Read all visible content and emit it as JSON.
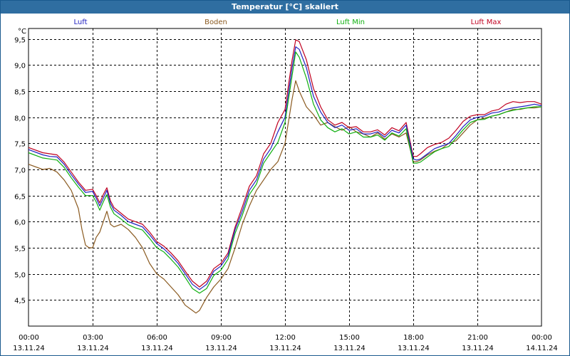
{
  "chart_data": {
    "type": "line",
    "title": "Temperatur [°C] skaliert",
    "ylabel": "°C",
    "ylim": [
      4.0,
      9.7
    ],
    "yticks": [
      4.5,
      5.0,
      5.5,
      6.0,
      6.5,
      7.0,
      7.5,
      8.0,
      8.5,
      9.0,
      9.5
    ],
    "ytick_labels": [
      "4,5",
      "5,0",
      "5,5",
      "6,0",
      "6,5",
      "7,0",
      "7,5",
      "8,0",
      "8,5",
      "9,0",
      "9,5"
    ],
    "xlim": [
      "13.11.24 00:00",
      "14.11.24 00:00"
    ],
    "xticks": [
      {
        "time": "00:00",
        "date": "13.11.24"
      },
      {
        "time": "03:00",
        "date": "13.11.24"
      },
      {
        "time": "06:00",
        "date": "13.11.24"
      },
      {
        "time": "09:00",
        "date": "13.11.24"
      },
      {
        "time": "12:00",
        "date": "13.11.24"
      },
      {
        "time": "15:00",
        "date": "13.11.24"
      },
      {
        "time": "18:00",
        "date": "13.11.24"
      },
      {
        "time": "21:00",
        "date": "13.11.24"
      },
      {
        "time": "00:00",
        "date": "14.11.24"
      }
    ],
    "grid": true,
    "legend_position": "top",
    "series": [
      {
        "name": "Luft",
        "color": "#2020c0",
        "x": [
          "00:00",
          "00:40",
          "01:00",
          "01:20",
          "01:40",
          "02:00",
          "02:20",
          "02:40",
          "03:00",
          "03:10",
          "03:20",
          "03:30",
          "03:40",
          "03:50",
          "04:00",
          "04:20",
          "04:40",
          "05:00",
          "05:20",
          "05:40",
          "06:00",
          "06:20",
          "06:40",
          "07:00",
          "07:20",
          "07:40",
          "08:00",
          "08:20",
          "08:40",
          "09:00",
          "09:20",
          "09:40",
          "10:00",
          "10:20",
          "10:40",
          "11:00",
          "11:20",
          "11:40",
          "12:00",
          "12:20",
          "12:30",
          "12:40",
          "13:00",
          "13:20",
          "13:40",
          "14:00",
          "14:20",
          "14:40",
          "15:00",
          "15:20",
          "15:40",
          "16:00",
          "16:20",
          "16:40",
          "17:00",
          "17:20",
          "17:40",
          "18:00",
          "18:10",
          "18:20",
          "18:40",
          "19:00",
          "19:20",
          "19:40",
          "20:00",
          "20:20",
          "20:40",
          "21:00",
          "21:20",
          "21:40",
          "22:00",
          "22:20",
          "22:40",
          "23:00",
          "23:20",
          "23:40",
          "24:00"
        ],
        "y": [
          7.38,
          7.28,
          7.25,
          7.24,
          7.1,
          6.9,
          6.72,
          6.56,
          6.58,
          6.45,
          6.3,
          6.45,
          6.6,
          6.35,
          6.22,
          6.12,
          6.0,
          5.95,
          5.9,
          5.75,
          5.58,
          5.48,
          5.35,
          5.2,
          5.0,
          4.8,
          4.7,
          4.8,
          5.05,
          5.15,
          5.35,
          5.85,
          6.2,
          6.6,
          6.8,
          7.2,
          7.4,
          7.72,
          8.0,
          8.95,
          9.35,
          9.3,
          8.95,
          8.4,
          8.1,
          7.9,
          7.8,
          7.85,
          7.75,
          7.78,
          7.68,
          7.68,
          7.72,
          7.62,
          7.75,
          7.7,
          7.85,
          7.2,
          7.18,
          7.2,
          7.3,
          7.4,
          7.45,
          7.5,
          7.65,
          7.82,
          7.95,
          8.0,
          8.02,
          8.08,
          8.1,
          8.15,
          8.18,
          8.2,
          8.22,
          8.25,
          8.22
        ]
      },
      {
        "name": "Boden",
        "color": "#8a5a20",
        "x": [
          "00:00",
          "00:40",
          "01:00",
          "01:20",
          "01:40",
          "02:00",
          "02:20",
          "02:30",
          "02:40",
          "02:50",
          "03:00",
          "03:10",
          "03:20",
          "03:30",
          "03:40",
          "03:50",
          "04:00",
          "04:20",
          "04:40",
          "05:00",
          "05:20",
          "05:40",
          "06:00",
          "06:20",
          "06:40",
          "07:00",
          "07:20",
          "07:40",
          "07:50",
          "08:00",
          "08:20",
          "08:40",
          "09:00",
          "09:20",
          "09:40",
          "10:00",
          "10:20",
          "10:40",
          "11:00",
          "11:20",
          "11:40",
          "12:00",
          "12:20",
          "12:30",
          "12:40",
          "13:00",
          "13:20",
          "13:40",
          "14:00",
          "14:20",
          "14:40",
          "15:00",
          "15:20",
          "15:40",
          "16:00",
          "16:20",
          "16:40",
          "17:00",
          "17:20",
          "17:40",
          "18:00",
          "18:10",
          "18:20",
          "18:40",
          "19:00",
          "19:20",
          "19:40",
          "20:00",
          "20:20",
          "20:40",
          "21:00",
          "21:20",
          "21:40",
          "22:00",
          "22:20",
          "22:40",
          "23:00",
          "23:20",
          "23:40",
          "24:00"
        ],
        "y": [
          7.1,
          7.0,
          7.02,
          6.95,
          6.8,
          6.6,
          6.25,
          5.85,
          5.55,
          5.5,
          5.5,
          5.7,
          5.8,
          6.0,
          6.2,
          5.95,
          5.9,
          5.95,
          5.85,
          5.7,
          5.5,
          5.2,
          5.0,
          4.9,
          4.75,
          4.6,
          4.4,
          4.3,
          4.25,
          4.3,
          4.55,
          4.75,
          4.9,
          5.1,
          5.5,
          5.95,
          6.3,
          6.6,
          6.8,
          7.0,
          7.15,
          7.5,
          8.35,
          8.7,
          8.5,
          8.2,
          8.05,
          7.85,
          7.9,
          7.82,
          7.75,
          7.82,
          7.72,
          7.68,
          7.62,
          7.7,
          7.58,
          7.68,
          7.62,
          7.7,
          7.15,
          7.15,
          7.18,
          7.28,
          7.35,
          7.4,
          7.5,
          7.55,
          7.7,
          7.85,
          7.95,
          7.98,
          8.02,
          8.05,
          8.1,
          8.15,
          8.15,
          8.18,
          8.18,
          8.2
        ]
      },
      {
        "name": "Luft Min",
        "color": "#10b010",
        "x": [
          "00:00",
          "00:40",
          "01:00",
          "01:20",
          "01:40",
          "02:00",
          "02:20",
          "02:40",
          "03:00",
          "03:10",
          "03:20",
          "03:30",
          "03:40",
          "03:50",
          "04:00",
          "04:20",
          "04:40",
          "05:00",
          "05:20",
          "05:40",
          "06:00",
          "06:20",
          "06:40",
          "07:00",
          "07:20",
          "07:40",
          "08:00",
          "08:20",
          "08:40",
          "09:00",
          "09:20",
          "09:40",
          "10:00",
          "10:20",
          "10:40",
          "11:00",
          "11:20",
          "11:40",
          "12:00",
          "12:20",
          "12:30",
          "12:40",
          "13:00",
          "13:20",
          "13:40",
          "14:00",
          "14:20",
          "14:40",
          "15:00",
          "15:20",
          "15:40",
          "16:00",
          "16:20",
          "16:40",
          "17:00",
          "17:20",
          "17:40",
          "18:00",
          "18:10",
          "18:20",
          "18:40",
          "19:00",
          "19:20",
          "19:40",
          "20:00",
          "20:20",
          "20:40",
          "21:00",
          "21:20",
          "21:40",
          "22:00",
          "22:20",
          "22:40",
          "23:00",
          "23:20",
          "23:40",
          "24:00"
        ],
        "y": [
          7.32,
          7.22,
          7.2,
          7.18,
          7.04,
          6.84,
          6.66,
          6.5,
          6.5,
          6.38,
          6.22,
          6.38,
          6.52,
          6.28,
          6.15,
          6.05,
          5.94,
          5.88,
          5.84,
          5.68,
          5.5,
          5.42,
          5.28,
          5.13,
          4.93,
          4.72,
          4.63,
          4.72,
          4.97,
          5.07,
          5.28,
          5.78,
          6.12,
          6.52,
          6.72,
          7.12,
          7.32,
          7.52,
          7.9,
          8.8,
          9.25,
          9.15,
          8.75,
          8.25,
          7.95,
          7.8,
          7.72,
          7.78,
          7.68,
          7.72,
          7.62,
          7.62,
          7.66,
          7.56,
          7.7,
          7.64,
          7.78,
          7.12,
          7.12,
          7.14,
          7.24,
          7.34,
          7.4,
          7.44,
          7.6,
          7.76,
          7.9,
          7.95,
          7.96,
          8.02,
          8.05,
          8.1,
          8.13,
          8.16,
          8.18,
          8.2,
          8.2
        ]
      },
      {
        "name": "Luft Max",
        "color": "#c00020",
        "x": [
          "00:00",
          "00:40",
          "01:00",
          "01:20",
          "01:40",
          "02:00",
          "02:20",
          "02:40",
          "03:00",
          "03:10",
          "03:20",
          "03:30",
          "03:40",
          "03:50",
          "04:00",
          "04:20",
          "04:40",
          "05:00",
          "05:20",
          "05:40",
          "06:00",
          "06:20",
          "06:40",
          "07:00",
          "07:20",
          "07:40",
          "08:00",
          "08:20",
          "08:40",
          "09:00",
          "09:20",
          "09:40",
          "10:00",
          "10:20",
          "10:40",
          "11:00",
          "11:20",
          "11:40",
          "12:00",
          "12:20",
          "12:30",
          "12:40",
          "13:00",
          "13:20",
          "13:40",
          "14:00",
          "14:20",
          "14:40",
          "15:00",
          "15:20",
          "15:40",
          "16:00",
          "16:20",
          "16:40",
          "17:00",
          "17:20",
          "17:40",
          "18:00",
          "18:10",
          "18:20",
          "18:40",
          "19:00",
          "19:20",
          "19:40",
          "20:00",
          "20:20",
          "20:40",
          "21:00",
          "21:20",
          "21:40",
          "22:00",
          "22:20",
          "22:40",
          "23:00",
          "23:20",
          "23:40",
          "24:00"
        ],
        "y": [
          7.42,
          7.32,
          7.3,
          7.28,
          7.14,
          6.95,
          6.76,
          6.6,
          6.62,
          6.5,
          6.36,
          6.52,
          6.65,
          6.4,
          6.27,
          6.16,
          6.05,
          6.0,
          5.95,
          5.8,
          5.62,
          5.53,
          5.4,
          5.25,
          5.05,
          4.86,
          4.75,
          4.86,
          5.1,
          5.2,
          5.4,
          5.9,
          6.28,
          6.68,
          6.88,
          7.3,
          7.5,
          7.9,
          8.15,
          9.1,
          9.48,
          9.45,
          9.1,
          8.55,
          8.2,
          7.95,
          7.85,
          7.9,
          7.8,
          7.82,
          7.72,
          7.72,
          7.76,
          7.66,
          7.8,
          7.74,
          7.9,
          7.25,
          7.25,
          7.3,
          7.42,
          7.48,
          7.52,
          7.6,
          7.75,
          7.92,
          8.02,
          8.05,
          8.05,
          8.12,
          8.15,
          8.25,
          8.3,
          8.28,
          8.3,
          8.3,
          8.25
        ]
      }
    ]
  }
}
